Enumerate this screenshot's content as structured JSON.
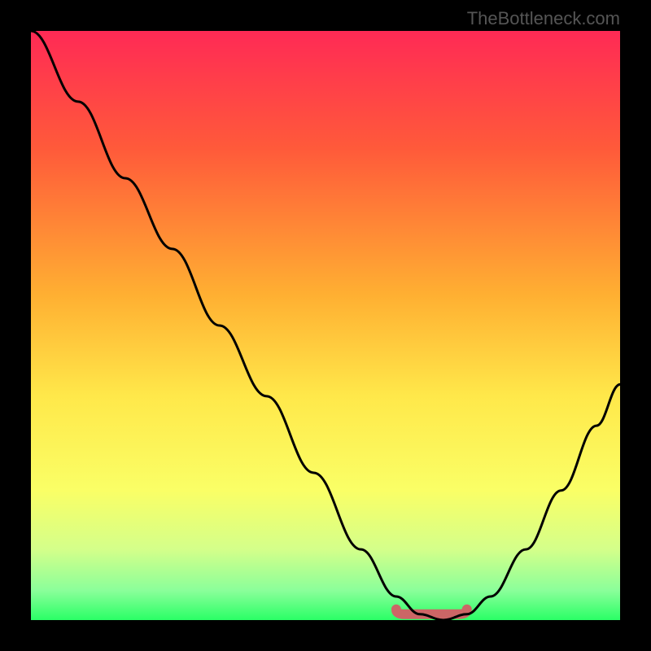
{
  "attribution": "TheBottleneck.com",
  "chart_data": {
    "type": "line",
    "title": "",
    "xlabel": "",
    "ylabel": "",
    "xlim": [
      0,
      100
    ],
    "ylim": [
      0,
      100
    ],
    "gradient_stops": [
      {
        "offset": 0,
        "color": "#ff2a55"
      },
      {
        "offset": 20,
        "color": "#ff5a3a"
      },
      {
        "offset": 45,
        "color": "#ffb032"
      },
      {
        "offset": 62,
        "color": "#ffe84a"
      },
      {
        "offset": 78,
        "color": "#faff66"
      },
      {
        "offset": 88,
        "color": "#d4ff8a"
      },
      {
        "offset": 95,
        "color": "#8aff9a"
      },
      {
        "offset": 100,
        "color": "#2aff66"
      }
    ],
    "series": [
      {
        "name": "bottleneck-curve",
        "x": [
          0,
          8,
          16,
          24,
          32,
          40,
          48,
          56,
          62,
          66,
          70,
          74,
          78,
          84,
          90,
          96,
          100
        ],
        "y": [
          100,
          88,
          75,
          63,
          50,
          38,
          25,
          12,
          4,
          1,
          0,
          1,
          4,
          12,
          22,
          33,
          40
        ]
      }
    ],
    "sweet_spot": {
      "x_start": 62,
      "x_end": 74,
      "y": 1
    }
  }
}
